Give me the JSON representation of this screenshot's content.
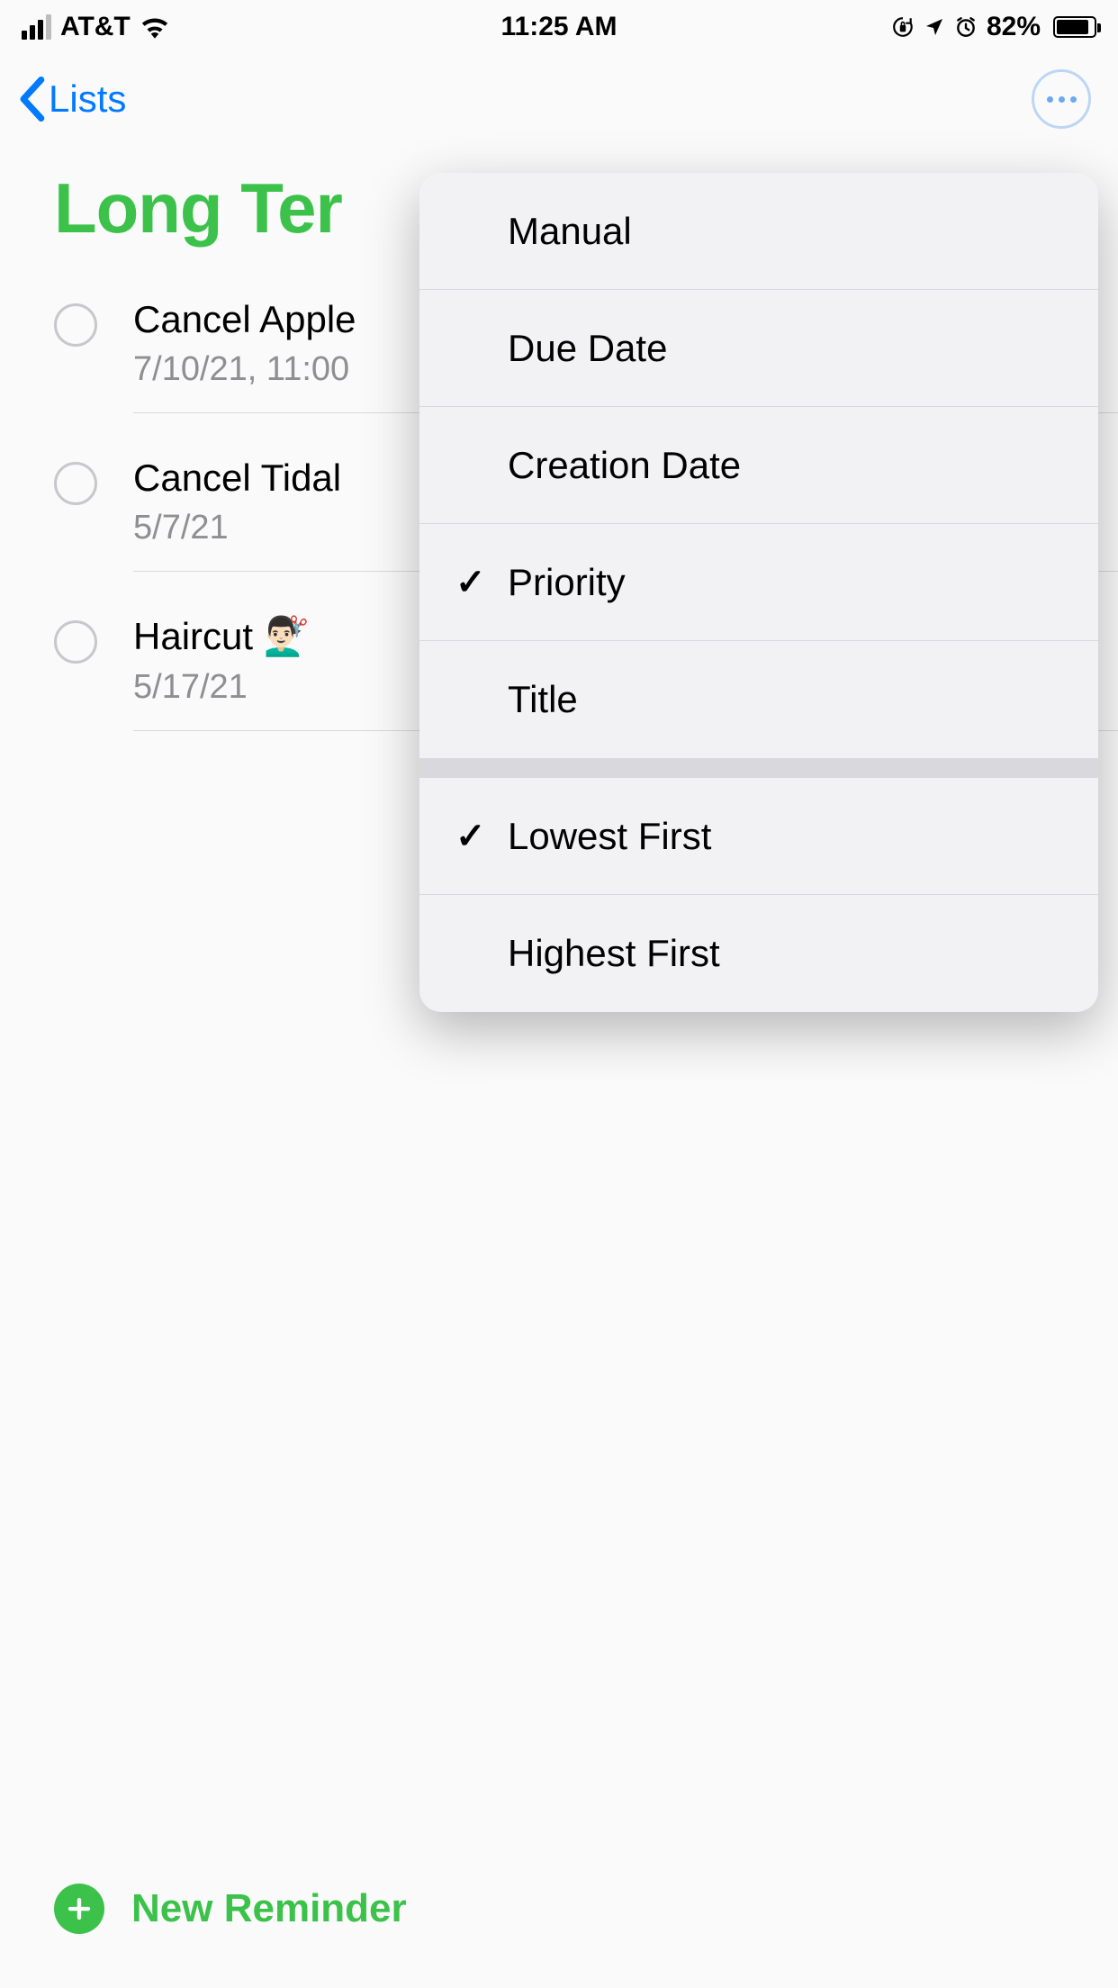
{
  "status": {
    "carrier": "AT&T",
    "time": "11:25 AM",
    "battery_pct": "82%"
  },
  "nav": {
    "back_label": "Lists"
  },
  "list": {
    "title": "Long Ter",
    "accent_color": "#3cc24a"
  },
  "reminders": [
    {
      "title": "Cancel Apple",
      "sub": "7/10/21, 11:00"
    },
    {
      "title": "Cancel Tidal",
      "sub": "5/7/21"
    },
    {
      "title": "Haircut 💇🏻‍♂️",
      "sub": "5/17/21"
    }
  ],
  "sort_menu": {
    "options": [
      {
        "label": "Manual",
        "checked": false
      },
      {
        "label": "Due Date",
        "checked": false
      },
      {
        "label": "Creation Date",
        "checked": false
      },
      {
        "label": "Priority",
        "checked": true
      },
      {
        "label": "Title",
        "checked": false
      }
    ],
    "direction": [
      {
        "label": "Lowest First",
        "checked": true
      },
      {
        "label": "Highest First",
        "checked": false
      }
    ]
  },
  "footer": {
    "new_reminder_label": "New Reminder"
  }
}
